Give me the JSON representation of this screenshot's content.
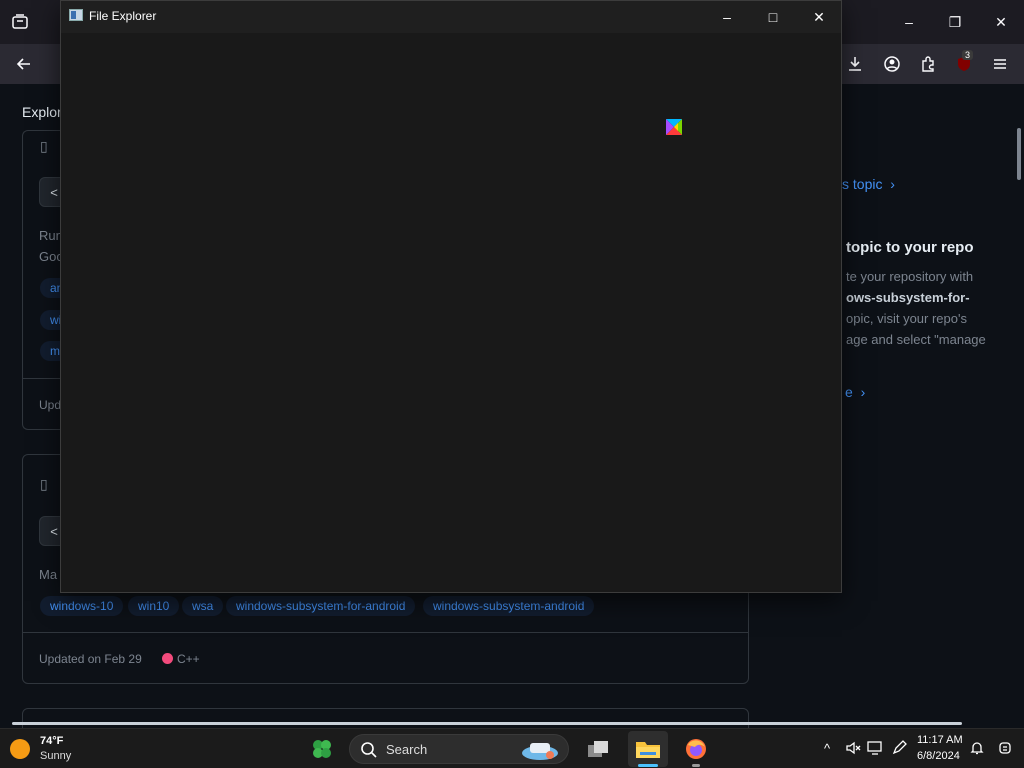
{
  "browser": {
    "extension_badge": "3"
  },
  "page": {
    "breadcrumb": "Explore",
    "card1": {
      "desc_line1": "Run",
      "desc_line2": "Goo",
      "chips": [
        "an",
        "wi",
        "m"
      ],
      "updated": "Upd"
    },
    "card2": {
      "desc": "Ma",
      "chips": [
        "windows-10",
        "win10",
        "wsa",
        "windows-subsystem-for-android",
        "windows-subsystem-android"
      ],
      "updated": "Updated on Feb 29",
      "language": "C++"
    },
    "sidebar": {
      "link_topic": "s topic",
      "heading": "topic to your repo",
      "para_lines": [
        "te your repository with",
        "ows-subsystem-for-",
        "opic, visit your repo's",
        "age and select \"manage"
      ],
      "link_more": "e"
    }
  },
  "file_explorer": {
    "title": "File Explorer",
    "minimize": "–",
    "maximize": "□",
    "close": "✕"
  },
  "taskbar": {
    "weather_temp": "74°F",
    "weather_condition": "Sunny",
    "search_label": "Search",
    "clock_time": "11:17 AM",
    "clock_date": "6/8/2024"
  }
}
